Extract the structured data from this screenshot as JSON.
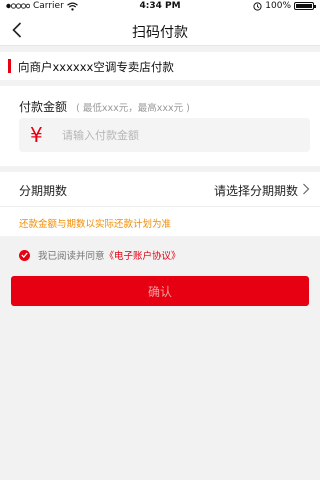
{
  "status_bar": {
    "carrier": "Carrier",
    "time": "4:34 PM",
    "battery": "100%",
    "signal_icon": "signal-dots-icon",
    "wifi_icon": "wifi-icon",
    "alarm_icon": "alarm-lock-icon",
    "battery_icon": "battery-icon"
  },
  "nav": {
    "title": "扫码付款",
    "back_icon": "chevron-left-icon"
  },
  "merchant": {
    "text": "向商户xxxxxx空调专卖店付款"
  },
  "amount": {
    "label": "付款金额",
    "hint": "( 最低xxx元，最高xxx元 )",
    "currency_symbol": "¥",
    "placeholder": "请输入付款金额"
  },
  "installment": {
    "label": "分期期数",
    "value": "请选择分期期数",
    "chevron_icon": "chevron-right-icon"
  },
  "notice": {
    "text": "还款金额与期数以实际还款计划为准"
  },
  "agreement": {
    "checked": true,
    "prefix": "我已阅读并同意",
    "link": "《电子账户协议》",
    "check_icon": "check-circle-icon"
  },
  "confirm": {
    "label": "确认"
  },
  "colors": {
    "accent": "#e60012",
    "notice": "#f08c00",
    "background": "#f2f2f2"
  }
}
